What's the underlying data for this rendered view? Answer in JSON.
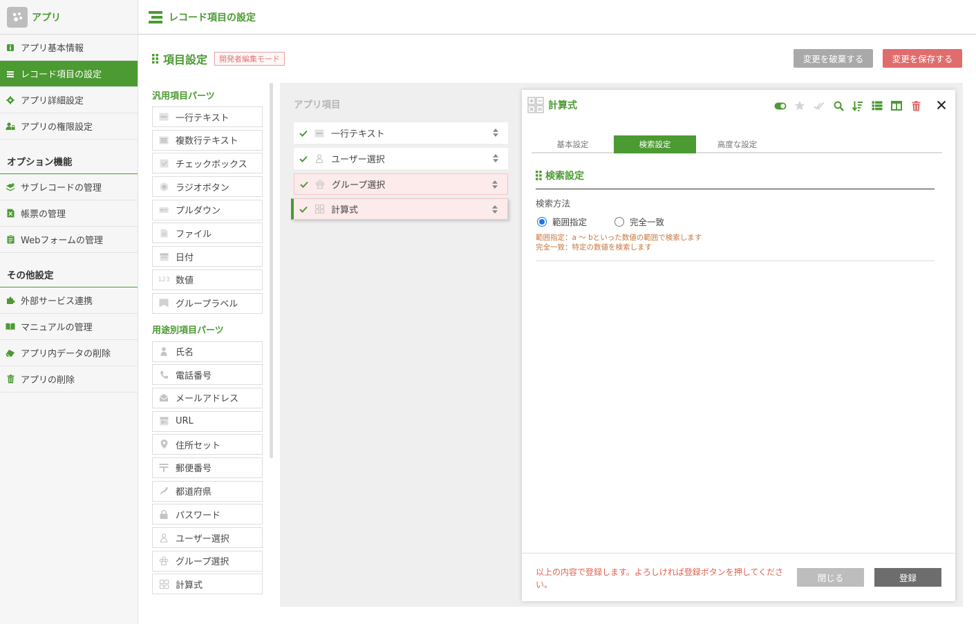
{
  "app": {
    "name": "アプリ"
  },
  "sidebar": {
    "items": [
      {
        "label": "アプリ基本情報",
        "icon": "info-icon"
      },
      {
        "label": "レコード項目の設定",
        "icon": "list-icon",
        "active": true
      },
      {
        "label": "アプリ詳細設定",
        "icon": "gear-icon"
      },
      {
        "label": "アプリの権限設定",
        "icon": "user-lock-icon"
      }
    ],
    "sections": [
      {
        "title": "オプション機能",
        "items": [
          {
            "label": "サブレコードの管理",
            "icon": "layers-icon"
          },
          {
            "label": "帳票の管理",
            "icon": "excel-icon"
          },
          {
            "label": "Webフォームの管理",
            "icon": "clipboard-icon"
          }
        ]
      },
      {
        "title": "その他設定",
        "items": [
          {
            "label": "外部サービス連携",
            "icon": "puzzle-icon"
          },
          {
            "label": "マニュアルの管理",
            "icon": "book-icon"
          },
          {
            "label": "アプリ内データの削除",
            "icon": "eraser-icon"
          },
          {
            "label": "アプリの削除",
            "icon": "trash-icon"
          }
        ]
      }
    ]
  },
  "header": {
    "title": "レコード項目の設定"
  },
  "page": {
    "title": "項目設定",
    "mode_badge": "開発者編集モード",
    "discard_label": "変更を破棄する",
    "save_label": "変更を保存する"
  },
  "parts": {
    "general_title": "汎用項目パーツ",
    "general": [
      "一行テキスト",
      "複数行テキスト",
      "チェックボックス",
      "ラジオボタン",
      "プルダウン",
      "ファイル",
      "日付",
      "数値",
      "グループラベル"
    ],
    "purpose_title": "用途別項目パーツ",
    "purpose": [
      "氏名",
      "電話番号",
      "メールアドレス",
      "URL",
      "住所セット",
      "郵便番号",
      "都道府県",
      "パスワード",
      "ユーザー選択",
      "グループ選択",
      "計算式"
    ],
    "number_icon_text": "123"
  },
  "app_items": {
    "title": "アプリ項目",
    "rows": [
      "一行テキスト",
      "ユーザー選択",
      "グループ選択",
      "計算式"
    ]
  },
  "panel": {
    "title": "計算式",
    "tabs": [
      "基本設定",
      "検索設定",
      "高度な設定"
    ],
    "active_tab": 1,
    "section_title": "検索設定",
    "method_label": "検索方法",
    "options": [
      "範囲指定",
      "完全一致"
    ],
    "selected_option": 0,
    "hint_range": "範囲指定：a 〜 bといった数値の範囲で検索します",
    "hint_exact": "完全一致：特定の数値を検索します",
    "footer_note": "以上の内容で登録します。よろしければ登録ボタンを押してください。",
    "close_label": "閉じる",
    "register_label": "登録"
  },
  "colors": {
    "brand": "#4b9a32",
    "danger": "#e06c6c",
    "accent_radio": "#1a73e8"
  }
}
